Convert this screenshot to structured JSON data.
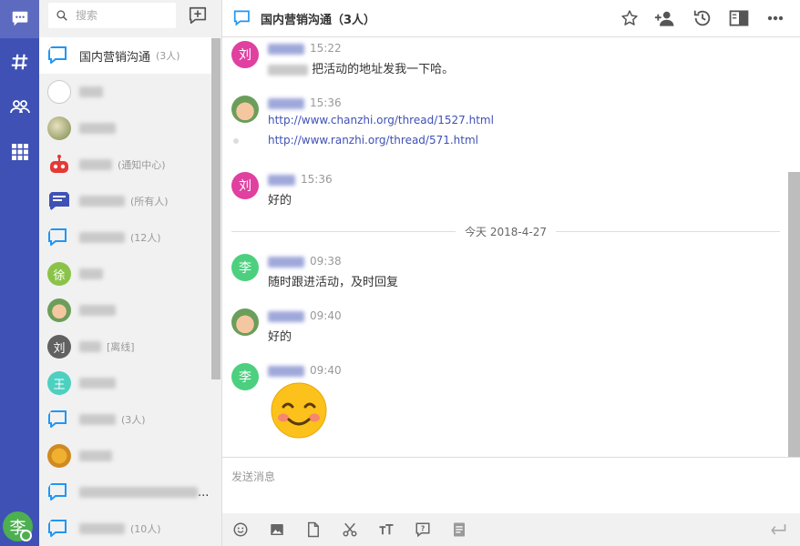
{
  "rail": {
    "user_avatar_char": "李"
  },
  "search": {
    "placeholder": "搜索"
  },
  "conversations": [
    {
      "name": "国内营销沟通",
      "sub": "(3人)",
      "type": "group",
      "active": true
    },
    {
      "name_blurred": true,
      "sub": "",
      "type": "white"
    },
    {
      "name_blurred": true,
      "sub": "",
      "type": "photo-cat"
    },
    {
      "name_blurred": true,
      "sub": "(通知中心)",
      "type": "robot"
    },
    {
      "name_blurred": true,
      "sub": "(所有人)",
      "type": "board"
    },
    {
      "name_blurred": true,
      "sub": "(12人)",
      "type": "group"
    },
    {
      "name_blurred": true,
      "avatar_char": "徐",
      "sub": "",
      "type": "green"
    },
    {
      "name_blurred": true,
      "sub": "",
      "type": "photo-man"
    },
    {
      "name_blurred": true,
      "avatar_char": "刘",
      "sub": "[离线]",
      "type": "gray"
    },
    {
      "name_blurred": true,
      "avatar_char": "王",
      "sub": "",
      "type": "teal"
    },
    {
      "name_blurred": true,
      "sub": "(3人)",
      "type": "group"
    },
    {
      "name_blurred": true,
      "sub": "",
      "type": "photo-dog"
    },
    {
      "name_blurred": true,
      "name_suffix": "...",
      "sub": "",
      "type": "group"
    },
    {
      "name_blurred": true,
      "sub": "(10人)",
      "type": "group"
    }
  ],
  "header": {
    "title": "国内营销沟通（3人）"
  },
  "messages": [
    {
      "avatar_char": "刘",
      "time": "15:22",
      "text": "把活动的地址发我一下哈。"
    },
    {
      "avatar": "photo-man",
      "time": "15:36",
      "link": "http://www.chanzhi.org/thread/1527.html",
      "link2": "http://www.ranzhi.org/thread/571.html"
    },
    {
      "avatar_char": "刘",
      "time": "15:36",
      "text": "好的"
    },
    {
      "avatar_char": "李",
      "time": "09:38",
      "text": "随时跟进活动，及时回复"
    },
    {
      "avatar": "photo-man",
      "time": "09:40",
      "text": "好的"
    },
    {
      "avatar_char": "李",
      "time": "09:40",
      "emoji": "smile"
    }
  ],
  "divider": {
    "label": "今天 2018-4-27"
  },
  "composer": {
    "placeholder": "发送消息"
  },
  "colors": {
    "accent": "#3f51b5",
    "group_icon": "#2196f3",
    "pink": "#e040a0",
    "green": "#4cd080"
  }
}
